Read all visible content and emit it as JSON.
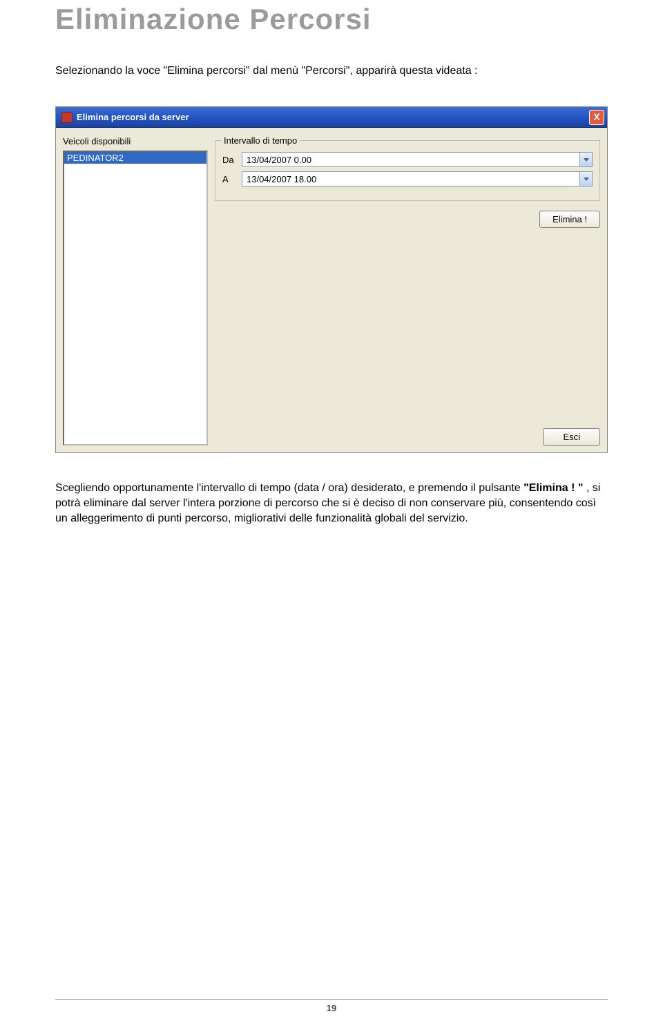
{
  "page": {
    "title": "Eliminazione Percorsi",
    "intro": "Selezionando la voce \"Elimina percorsi\" dal menù \"Percorsi\", apparirà questa videata :",
    "number": "19"
  },
  "dialog": {
    "title": "Elimina percorsi da server",
    "close_label": "X",
    "vehicles_label": "Veicoli disponibili",
    "vehicle_item": "PEDINATOR2",
    "interval_legend": "Intervallo di tempo",
    "from_label": "Da",
    "to_label": "A",
    "from_value": "13/04/2007   0.00",
    "to_value": "13/04/2007 18.00",
    "btn_elimina": "Elimina !",
    "btn_esci": "Esci"
  },
  "para": {
    "p1_pre": "Scegliendo opportunamente l'intervallo di tempo (data / ora) desiderato, e premendo il pulsante ",
    "p1_bold": "\"Elimina ! \"",
    "p1_post": " , si potrà eliminare dal server l'intera porzione di percorso che si è deciso di non conservare più, consentendo così un alleggerimento di punti percorso, migliorativi delle funzionalità globali del servizio."
  }
}
